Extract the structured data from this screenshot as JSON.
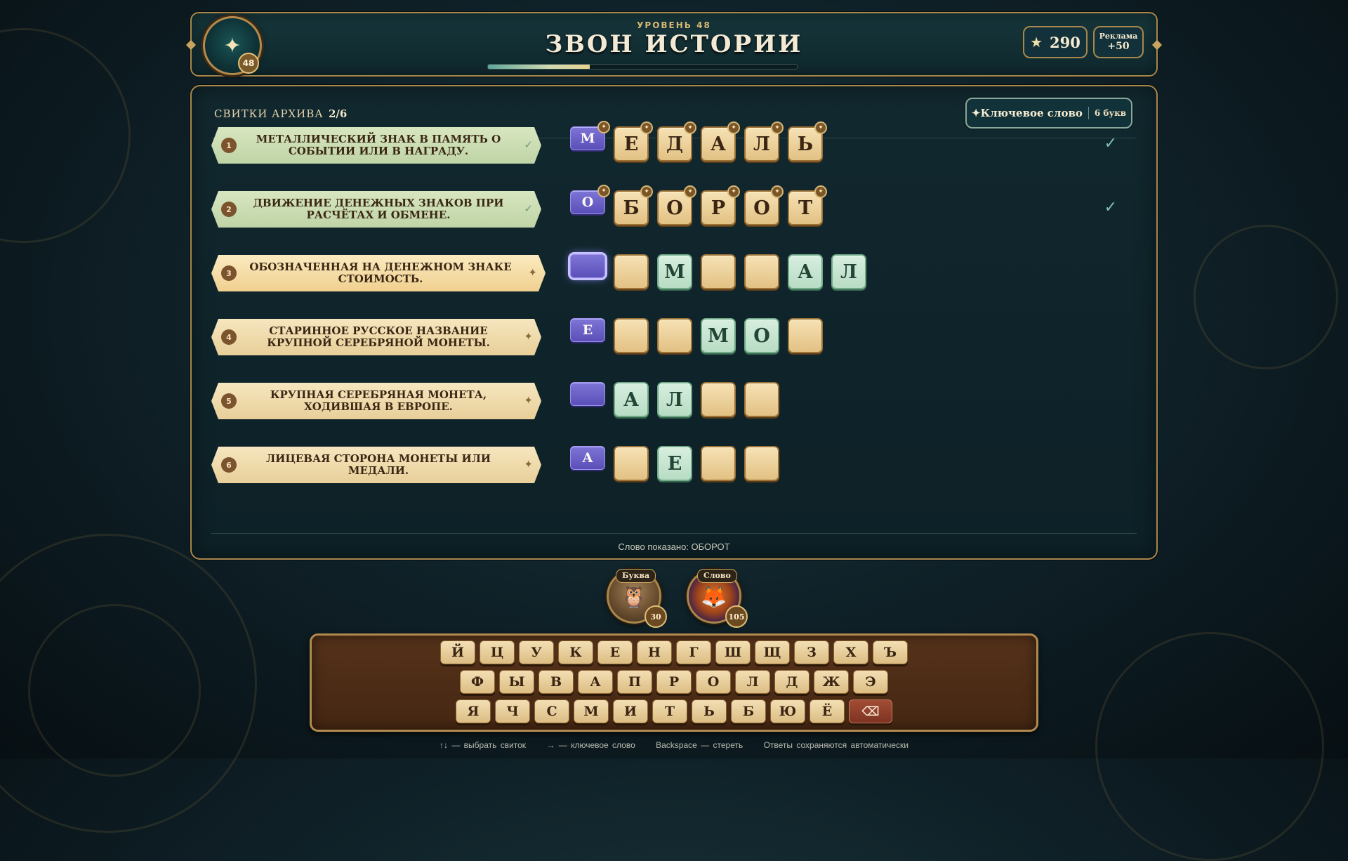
{
  "header": {
    "level_label": "УРОВЕНЬ 48",
    "title": "ЗВОН ИСТОРИИ",
    "level_badge": "48",
    "level_progress": 0.33,
    "stars_value": "290",
    "ad_label": "Реклама",
    "ad_bonus": "+50"
  },
  "panel": {
    "archive_label": "СВИТКИ АРХИВА",
    "archive_count": "2/6",
    "keyword_label": "✦Ключевое слово",
    "keyword_count": "6 букв",
    "shown_word": "Слово показано: ОБОРОТ"
  },
  "rows": [
    {
      "num": "1",
      "clue": "МЕТАЛЛИЧЕСКИЙ ЗНАК В ПАМЯТЬ О СОБЫТИИ ИЛИ В НАГРАДУ.",
      "index": "1",
      "state": "solved",
      "mark": "✓",
      "check": "✓",
      "tiles": [
        {
          "t": "М",
          "c": "key",
          "gem": true
        },
        {
          "t": "Е",
          "c": "gold",
          "gem": true
        },
        {
          "t": "Д",
          "c": "gold",
          "gem": true
        },
        {
          "t": "А",
          "c": "gold",
          "gem": true
        },
        {
          "t": "Л",
          "c": "gold",
          "gem": true
        },
        {
          "t": "Ь",
          "c": "gold",
          "gem": true
        }
      ]
    },
    {
      "num": "2",
      "clue": "ДВИЖЕНИЕ ДЕНЕЖНЫХ ЗНАКОВ ПРИ РАСЧЁТАХ И ОБМЕНЕ.",
      "index": "2",
      "state": "solved",
      "mark": "✓",
      "check": "✓",
      "tiles": [
        {
          "t": "О",
          "c": "key",
          "gem": true
        },
        {
          "t": "Б",
          "c": "gold",
          "gem": true
        },
        {
          "t": "О",
          "c": "gold",
          "gem": true
        },
        {
          "t": "Р",
          "c": "gold",
          "gem": true
        },
        {
          "t": "О",
          "c": "gold",
          "gem": true
        },
        {
          "t": "Т",
          "c": "gold",
          "gem": true
        }
      ]
    },
    {
      "num": "3",
      "clue": "ОБОЗНАЧЕННАЯ НА ДЕНЕЖНОМ ЗНАКЕ СТОИМОСТЬ.",
      "index": "3",
      "state": "active",
      "mark": "✦",
      "check": "",
      "tiles": [
        {
          "t": "",
          "c": "key sel"
        },
        {
          "t": "",
          "c": "gold"
        },
        {
          "t": "М",
          "c": "green"
        },
        {
          "t": "",
          "c": "gold"
        },
        {
          "t": "",
          "c": "gold"
        },
        {
          "t": "А",
          "c": "green"
        },
        {
          "t": "Л",
          "c": "green"
        }
      ]
    },
    {
      "num": "4",
      "clue": "СТАРИННОЕ РУССКОЕ НАЗВАНИЕ КРУПНОЙ СЕРЕБРЯНОЙ МОНЕТЫ.",
      "index": "4",
      "state": "open",
      "mark": "✦",
      "check": "",
      "tiles": [
        {
          "t": "Е",
          "c": "key"
        },
        {
          "t": "",
          "c": "gold"
        },
        {
          "t": "",
          "c": "gold"
        },
        {
          "t": "М",
          "c": "green"
        },
        {
          "t": "О",
          "c": "green"
        },
        {
          "t": "",
          "c": "gold"
        }
      ]
    },
    {
      "num": "5",
      "clue": "КРУПНАЯ СЕРЕБРЯНАЯ МОНЕТА, ХОДИВШАЯ В ЕВРОПЕ.",
      "index": "5",
      "state": "open",
      "mark": "✦",
      "check": "",
      "tiles": [
        {
          "t": "",
          "c": "key"
        },
        {
          "t": "А",
          "c": "green"
        },
        {
          "t": "Л",
          "c": "green"
        },
        {
          "t": "",
          "c": "gold"
        },
        {
          "t": "",
          "c": "gold"
        }
      ]
    },
    {
      "num": "6",
      "clue": "ЛИЦЕВАЯ СТОРОНА МОНЕТЫ ИЛИ МЕДАЛИ.",
      "index": "6",
      "state": "open",
      "mark": "✦",
      "check": "",
      "tiles": [
        {
          "t": "А",
          "c": "key"
        },
        {
          "t": "",
          "c": "gold"
        },
        {
          "t": "Е",
          "c": "green"
        },
        {
          "t": "",
          "c": "gold"
        },
        {
          "t": "",
          "c": "gold"
        }
      ]
    }
  ],
  "helpers": {
    "letter_label": "Буква",
    "letter_cost": "30",
    "word_label": "Слово",
    "word_cost": "105"
  },
  "keyboard": {
    "row1": [
      "Й",
      "Ц",
      "У",
      "К",
      "Е",
      "Н",
      "Г",
      "Ш",
      "Щ",
      "З",
      "Х",
      "Ъ"
    ],
    "row2": [
      "Ф",
      "Ы",
      "В",
      "А",
      "П",
      "Р",
      "О",
      "Л",
      "Д",
      "Ж",
      "Э"
    ],
    "row3": [
      "Я",
      "Ч",
      "С",
      "М",
      "И",
      "Т",
      "Ь",
      "Б",
      "Ю",
      "Ё"
    ],
    "backspace": "⌫"
  },
  "hints": [
    "↑↓ — выбрать свиток",
    "→ — ключевое слово",
    "Backspace — стереть",
    "Ответы сохраняются автоматически"
  ],
  "colors": {
    "accent_gold": "#a8874c",
    "key_tile": "#6a60c8",
    "hint_tile": "#c8e6d0",
    "panel": "#0f262c"
  },
  "icons": {
    "level": "sparkle-icon",
    "stars": "star-icon",
    "solved": "check-icon",
    "hint": "sparkle-icon",
    "owl": "owl-helper-icon",
    "fox": "fox-helper-icon",
    "backspace": "backspace-icon"
  }
}
